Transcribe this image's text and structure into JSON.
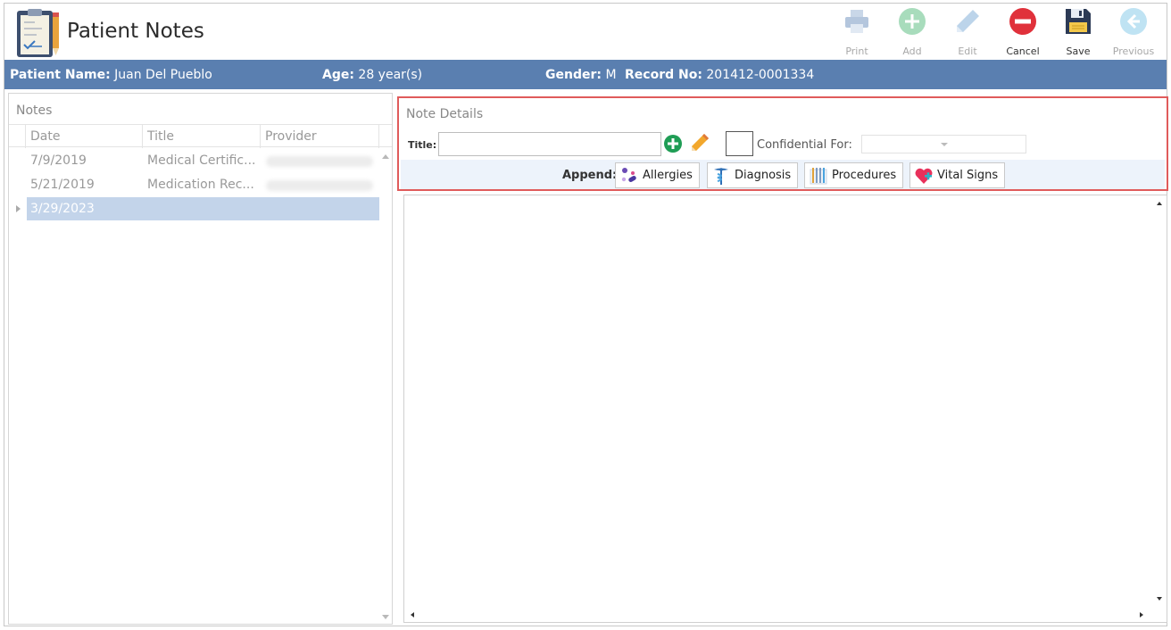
{
  "app": {
    "title": "Patient Notes",
    "icon": "clipboard-notes-icon"
  },
  "toolbar": {
    "buttons": [
      {
        "label": "Print",
        "icon": "printer-icon",
        "enabled": false
      },
      {
        "label": "Add",
        "icon": "plus-circle-icon",
        "enabled": false
      },
      {
        "label": "Edit",
        "icon": "pencil-icon",
        "enabled": false
      },
      {
        "label": "Cancel",
        "icon": "cancel-circle-icon",
        "enabled": true
      },
      {
        "label": "Save",
        "icon": "floppy-disk-icon",
        "enabled": true
      },
      {
        "label": "Previous",
        "icon": "arrow-left-circle-icon",
        "enabled": false
      }
    ]
  },
  "patient": {
    "name_label": "Patient Name:",
    "name": "Juan Del Pueblo",
    "age_label": "Age:",
    "age": "28 year(s)",
    "gender_label": "Gender:",
    "gender": "M",
    "record_label": "Record No:",
    "record": "201412-0001334",
    "bar_color": "#5a7fb0"
  },
  "notes": {
    "panel_title": "Notes",
    "columns": [
      "Date",
      "Title",
      "Provider"
    ],
    "rows": [
      {
        "date": "7/9/2019",
        "title": "Medical Certific...",
        "provider": ""
      },
      {
        "date": "5/21/2019",
        "title": "Medication Rec...",
        "provider": ""
      },
      {
        "date": "3/29/2023",
        "title": "",
        "provider": "",
        "selected": true
      }
    ]
  },
  "details": {
    "panel_title": "Note Details",
    "title_label": "Title:",
    "title_value": "",
    "confidential_label": "Confidential For:",
    "confidential_value": "",
    "append_label": "Append:",
    "append_buttons": [
      {
        "label": "Allergies",
        "icon": "pills-icon"
      },
      {
        "label": "Diagnosis",
        "icon": "caduceus-icon"
      },
      {
        "label": "Procedures",
        "icon": "surgical-tools-icon"
      },
      {
        "label": "Vital Signs",
        "icon": "heart-pulse-icon"
      }
    ],
    "highlight_color": "#e05b5b"
  },
  "editor": {
    "content": ""
  }
}
